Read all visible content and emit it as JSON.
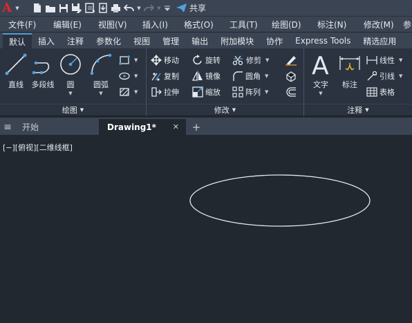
{
  "app": {
    "logo": "A",
    "share_label": "共享"
  },
  "menus": [
    "文件(F)",
    "编辑(E)",
    "视图(V)",
    "插入(I)",
    "格式(O)",
    "工具(T)",
    "绘图(D)",
    "标注(N)",
    "修改(M)",
    "参"
  ],
  "ribbon_tabs": [
    "默认",
    "插入",
    "注释",
    "参数化",
    "视图",
    "管理",
    "输出",
    "附加模块",
    "协作",
    "Express Tools",
    "精选应用"
  ],
  "panels": {
    "draw": {
      "title": "绘图",
      "tools": {
        "line": "直线",
        "polyline": "多段线",
        "circle": "圆",
        "arc": "圆弧"
      }
    },
    "modify": {
      "title": "修改",
      "tools": {
        "move": "移动",
        "rotate": "旋转",
        "trim": "修剪",
        "copy": "复制",
        "mirror": "镜像",
        "fillet": "圆角",
        "stretch": "拉伸",
        "scale": "缩放",
        "array": "阵列"
      }
    },
    "annotation": {
      "title": "注释",
      "tools": {
        "text": "文字",
        "dimension": "标注",
        "linear": "线性",
        "leader": "引线",
        "table": "表格"
      }
    }
  },
  "doc_tabs": {
    "start": "开始",
    "drawing": "Drawing1*",
    "add": "+",
    "close": "✕"
  },
  "viewport": {
    "label": "[−][俯视][二维线框]"
  }
}
